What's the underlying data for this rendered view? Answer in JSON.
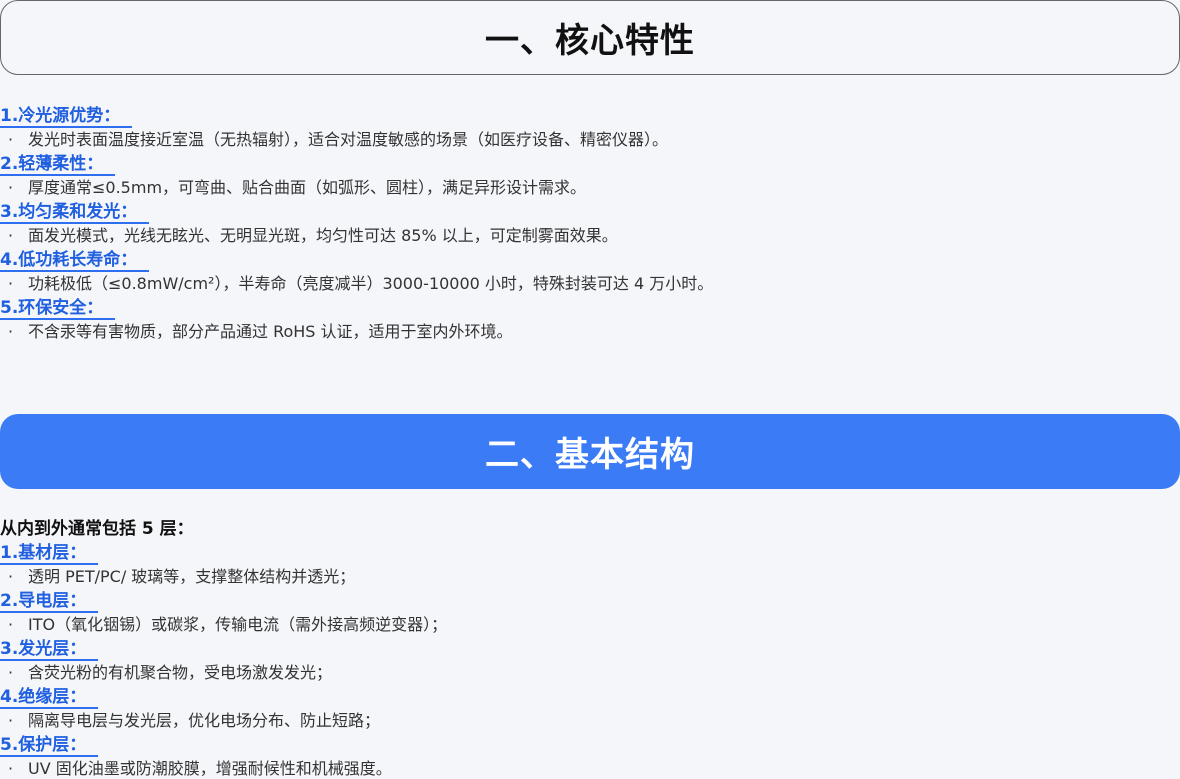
{
  "section1": {
    "title": "一、核心特性",
    "items": [
      {
        "heading": "1.冷光源优势：",
        "bullet_symbol": "·",
        "text": "发光时表面温度接近室温（无热辐射），适合对温度敏感的场景（如医疗设备、精密仪器）。"
      },
      {
        "heading": "2.轻薄柔性：",
        "bullet_symbol": "·",
        "text": "厚度通常≤0.5mm，可弯曲、贴合曲面（如弧形、圆柱），满足异形设计需求。"
      },
      {
        "heading": "3.均匀柔和发光：",
        "bullet_symbol": "·",
        "text": "面发光模式，光线无眩光、无明显光斑，均匀性可达 85% 以上，可定制雾面效果。"
      },
      {
        "heading": "4.低功耗长寿命：",
        "bullet_symbol": "·",
        "text": "功耗极低（≤0.8mW/cm²），半寿命（亮度减半）3000-10000 小时，特殊封装可达 4 万小时。"
      },
      {
        "heading": "5.环保安全：",
        "bullet_symbol": "·",
        "text": "不含汞等有害物质，部分产品通过 RoHS 认证，适用于室内外环境。"
      }
    ]
  },
  "section2": {
    "title": "二、基本结构",
    "intro": "从内到外通常包括 5 层：",
    "items": [
      {
        "heading": "1.基材层：",
        "bullet_symbol": "·",
        "text": "透明 PET/PC/ 玻璃等，支撑整体结构并透光；"
      },
      {
        "heading": "2.导电层：",
        "bullet_symbol": "·",
        "text": "ITO（氧化铟锡）或碳浆，传输电流（需外接高频逆变器）；"
      },
      {
        "heading": "3.发光层：",
        "bullet_symbol": "·",
        "text": "含荧光粉的有机聚合物，受电场激发发光；"
      },
      {
        "heading": "4.绝缘层：",
        "bullet_symbol": "·",
        "text": "隔离导电层与发光层，优化电场分布、防止短路；"
      },
      {
        "heading": "5.保护层：",
        "bullet_symbol": "·",
        "text": "UV 固化油墨或防潮胶膜，增强耐候性和机械强度。"
      }
    ]
  }
}
